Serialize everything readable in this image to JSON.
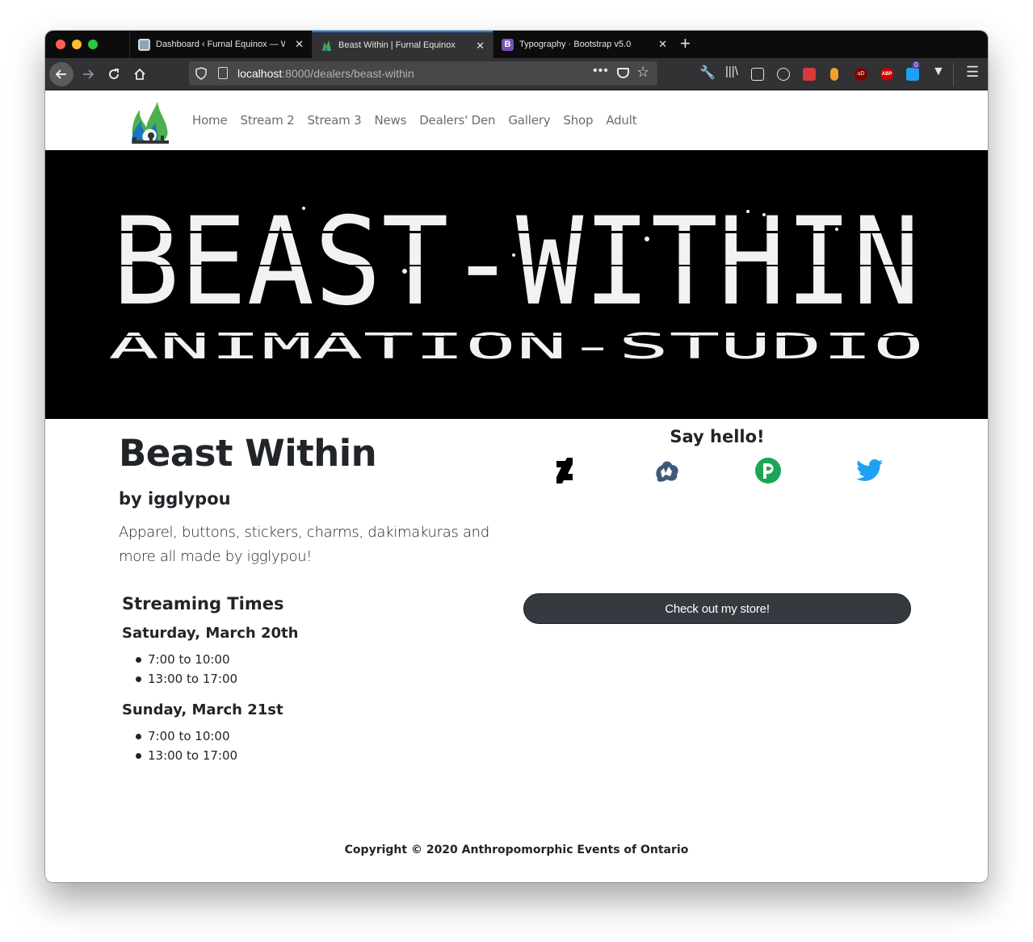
{
  "browser": {
    "tabs": [
      {
        "title": "Dashboard ‹ Furnal Equinox — WordPress",
        "active": false,
        "favicon_color": "#b6b6b6"
      },
      {
        "title": "Beast Within | Furnal Equinox",
        "active": true,
        "favicon_color": "#4caf50"
      },
      {
        "title": "Typography · Bootstrap v5.0",
        "active": false,
        "favicon_color": "#7952b3",
        "favicon_letter": "B"
      }
    ],
    "url": {
      "host": "localhost",
      "rest": ":8000/dealers/beast-within"
    },
    "close_glyph": "✕",
    "new_tab_glyph": "+",
    "extension_badge": "0",
    "ext_labels": {
      "ublock": "uD",
      "abp": "ABP"
    }
  },
  "site": {
    "nav": [
      "Home",
      "Stream 2",
      "Stream 3",
      "News",
      "Dealers' Den",
      "Gallery",
      "Shop",
      "Adult"
    ],
    "banner_text": {
      "line1": "BEAST-WITHIN",
      "line2": "ANIMATION-STUDIO"
    }
  },
  "dealer": {
    "name": "Beast Within",
    "byline": "by igglypou",
    "description": "Apparel, buttons, stickers, charms, dakimakuras and more all made by igglypou!"
  },
  "social": {
    "heading": "Say hello!",
    "links": [
      {
        "icon": "deviantart-icon",
        "color": "#000000"
      },
      {
        "icon": "furaffinity-icon",
        "color": "#3c5a78"
      },
      {
        "icon": "picarto-icon",
        "color": "#1da456"
      },
      {
        "icon": "twitter-icon",
        "color": "#1da1f2"
      }
    ],
    "store_label": "Check out my store!"
  },
  "streaming": {
    "heading": "Streaming Times",
    "days": [
      {
        "label": "Saturday, March 20th",
        "slots": [
          "7:00 to 10:00",
          "13:00 to 17:00"
        ]
      },
      {
        "label": "Sunday, March 21st",
        "slots": [
          "7:00 to 10:00",
          "13:00 to 17:00"
        ]
      }
    ]
  },
  "footer": {
    "text": "Copyright © 2020 Anthropomorphic Events of Ontario"
  }
}
